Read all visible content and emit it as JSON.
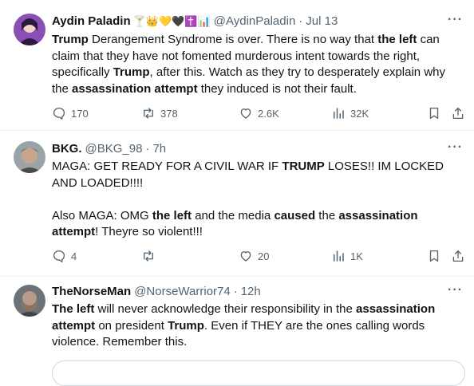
{
  "tweets": [
    {
      "name": "Aydin Paladin",
      "emojis": "🍸👑💛🖤✝️📊",
      "handle": "@AydinPaladin",
      "dot": "·",
      "time": "Jul 13",
      "more": "···",
      "body_segments": [
        {
          "text": "Trump",
          "bold": true
        },
        {
          "text": " Derangement Syndrome is over. There is no way that ",
          "bold": false
        },
        {
          "text": "the left",
          "bold": true
        },
        {
          "text": " can claim that they have not fomented murderous intent towards the right, specifically ",
          "bold": false
        },
        {
          "text": "Trump",
          "bold": true
        },
        {
          "text": ", after this. Watch as they try to desperately explain why the ",
          "bold": false
        },
        {
          "text": "assassination attempt",
          "bold": true
        },
        {
          "text": " they induced is not their fault.",
          "bold": false
        }
      ],
      "replies": "170",
      "reposts": "378",
      "likes": "2.6K",
      "views": "32K"
    },
    {
      "name": "BKG.",
      "handle": "@BKG_98",
      "dot": "·",
      "time": "7h",
      "more": "···",
      "body_segments": [
        {
          "text": "MAGA: GET READY FOR A CIVIL WAR IF ",
          "bold": false
        },
        {
          "text": "TRUMP",
          "bold": true
        },
        {
          "text": " LOSES!! IM LOCKED AND LOADED!!!!",
          "bold": false
        },
        {
          "text": "\n\n",
          "bold": false
        },
        {
          "text": "Also MAGA: OMG ",
          "bold": false
        },
        {
          "text": "the left",
          "bold": true
        },
        {
          "text": " and the media ",
          "bold": false
        },
        {
          "text": "caused",
          "bold": true
        },
        {
          "text": " the ",
          "bold": false
        },
        {
          "text": "assassination attempt",
          "bold": true
        },
        {
          "text": "! Theyre so violent!!!",
          "bold": false
        }
      ],
      "replies": "4",
      "reposts": "",
      "likes": "20",
      "views": "1K"
    },
    {
      "name": "TheNorseMan",
      "handle": "@NorseWarrior74",
      "dot": "·",
      "time": "12h",
      "more": "···",
      "body_segments": [
        {
          "text": "The left",
          "bold": true
        },
        {
          "text": " will never acknowledge their responsibility in the ",
          "bold": false
        },
        {
          "text": "assassination attempt",
          "bold": true
        },
        {
          "text": " on president ",
          "bold": false
        },
        {
          "text": "Trump",
          "bold": true
        },
        {
          "text": ". Even if THEY are the ones calling words violence. Remember this.",
          "bold": false
        }
      ]
    }
  ],
  "colors": {
    "text": "#0f1419",
    "muted": "#536471",
    "divider": "#eff3f4"
  }
}
